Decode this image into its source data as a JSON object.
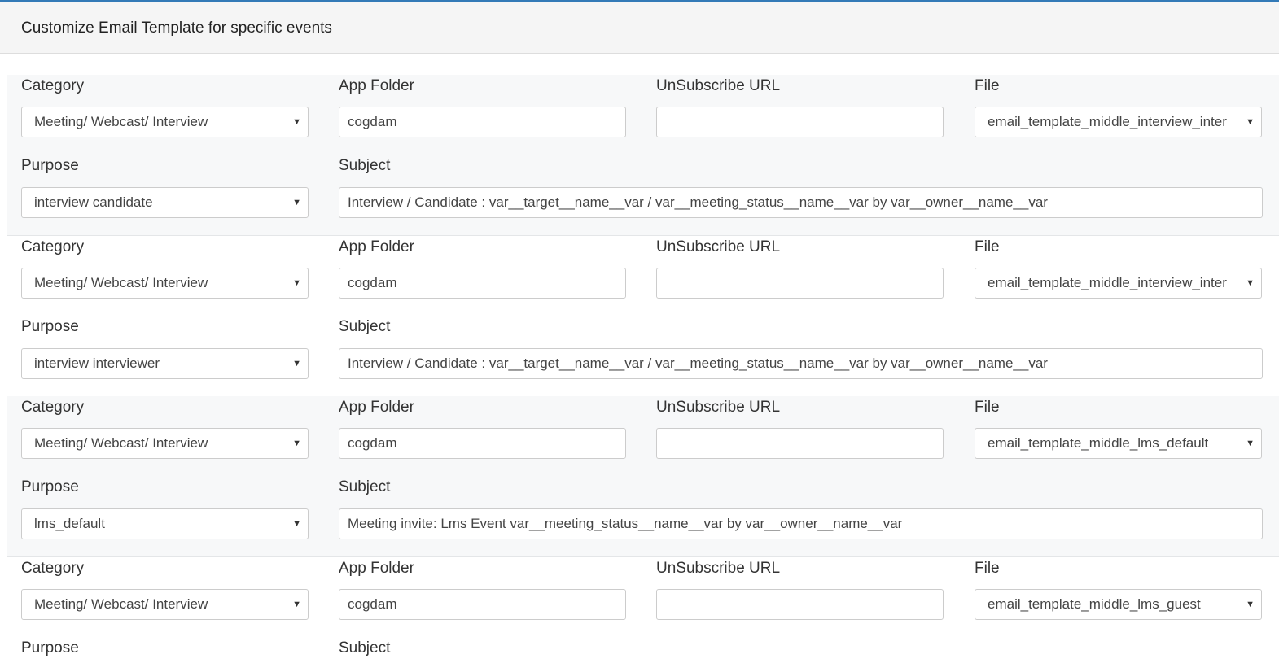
{
  "panel": {
    "title": "Customize Email Template for specific events"
  },
  "labels": {
    "category": "Category",
    "app_folder": "App Folder",
    "unsubscribe_url": "UnSubscribe URL",
    "file": "File",
    "purpose": "Purpose",
    "subject": "Subject"
  },
  "icons": {
    "dropdown": "caret-down-icon",
    "dropdown_glyph": "▼"
  },
  "colors": {
    "accent": "#337ab7",
    "heading_bg": "#f5f5f5",
    "row_shaded_bg": "#f7f8f9",
    "border": "#cccccc"
  },
  "templates": [
    {
      "category": "Meeting/ Webcast/ Interview",
      "app_folder": "cogdam",
      "unsubscribe_url": "",
      "file": "email_template_middle_interview_inter",
      "purpose": "interview candidate",
      "subject": "Interview / Candidate : var__target__name__var / var__meeting_status__name__var by var__owner__name__var"
    },
    {
      "category": "Meeting/ Webcast/ Interview",
      "app_folder": "cogdam",
      "unsubscribe_url": "",
      "file": "email_template_middle_interview_inter",
      "purpose": "interview interviewer",
      "subject": "Interview / Candidate : var__target__name__var / var__meeting_status__name__var by var__owner__name__var"
    },
    {
      "category": "Meeting/ Webcast/ Interview",
      "app_folder": "cogdam",
      "unsubscribe_url": "",
      "file": "email_template_middle_lms_default",
      "purpose": "lms_default",
      "subject": "Meeting invite: Lms Event var__meeting_status__name__var by var__owner__name__var"
    },
    {
      "category": "Meeting/ Webcast/ Interview",
      "app_folder": "cogdam",
      "unsubscribe_url": "",
      "file": "email_template_middle_lms_guest",
      "purpose": "",
      "subject": ""
    }
  ]
}
